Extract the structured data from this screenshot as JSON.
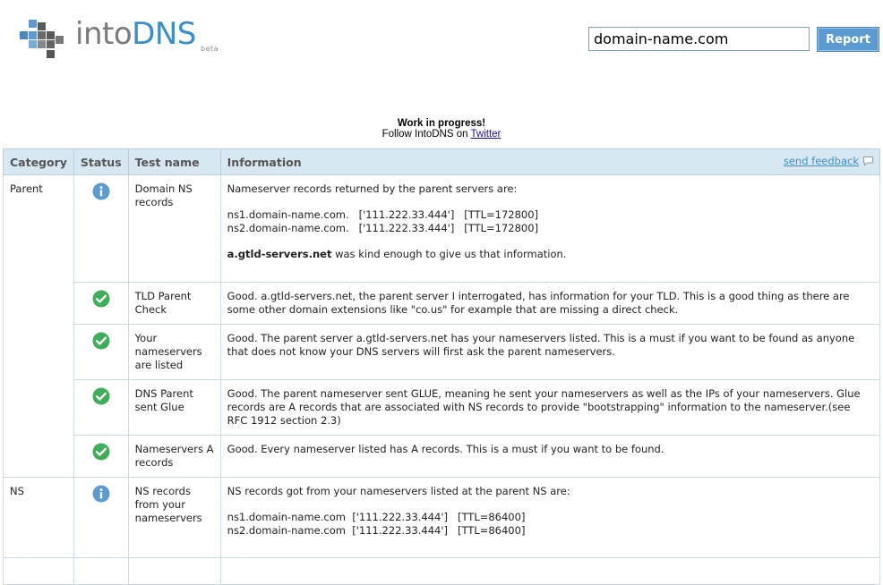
{
  "logo": {
    "into": "into",
    "dns": "DNS",
    "beta": "beta"
  },
  "search": {
    "value": "domain-name.com",
    "button": "Report"
  },
  "notice": {
    "title": "Work in progress!",
    "follow": "Follow IntoDNS on",
    "twitter": "Twitter"
  },
  "table": {
    "headers": {
      "category": "Category",
      "status": "Status",
      "test": "Test name",
      "info": "Information"
    },
    "feedback": "send feedback",
    "rows": [
      {
        "category": "Parent",
        "status": "info",
        "test": "Domain NS records",
        "info": {
          "intro": "Nameserver records returned by the parent servers are:",
          "lines": [
            "ns1.domain-name.com.   ['111.222.33.444']   [TTL=172800]",
            "ns2.domain-name.com.   ['111.222.33.444']   [TTL=172800]"
          ],
          "bold": "a.gtld-servers.net",
          "tail": " was kind enough to give us that information."
        }
      },
      {
        "category": "",
        "status": "ok",
        "test": "TLD Parent Check",
        "info": "Good. a.gtld-servers.net, the parent server I interrogated, has information for your TLD. This is a good thing as there are some other domain extensions like \"co.us\" for example that are missing a direct check."
      },
      {
        "category": "",
        "status": "ok",
        "test": "Your nameservers are listed",
        "info": "Good. The parent server a.gtld-servers.net has your nameservers listed. This is a must if you want to be found as anyone that does not know your DNS servers will first ask the parent nameservers."
      },
      {
        "category": "",
        "status": "ok",
        "test": "DNS Parent sent Glue",
        "info": "Good. The parent nameserver sent GLUE, meaning he sent your nameservers as well as the IPs of your nameservers. Glue records are A records that are associated with NS records to provide \"bootstrapping\" information to the nameserver.(see RFC 1912 section 2.3)"
      },
      {
        "category": "",
        "status": "ok",
        "test": "Nameservers A records",
        "info": "Good. Every nameserver listed has A records. This is a must if you want to be found."
      },
      {
        "category": "NS",
        "status": "info",
        "test": "NS records from your nameservers",
        "info": {
          "intro": "NS records got from your nameservers listed at the parent NS are:",
          "lines": [
            "ns1.domain-name.com  ['111.222.33.444']   [TTL=86400]",
            "ns2.domain-name.com  ['111.222.33.444']   [TTL=86400]"
          ]
        }
      }
    ]
  },
  "colors": {
    "info_icon": "#5b9bd0",
    "ok_icon": "#3fae5a",
    "header_bg": "#d8e8f3",
    "brand_blue": "#3a8fc9"
  }
}
